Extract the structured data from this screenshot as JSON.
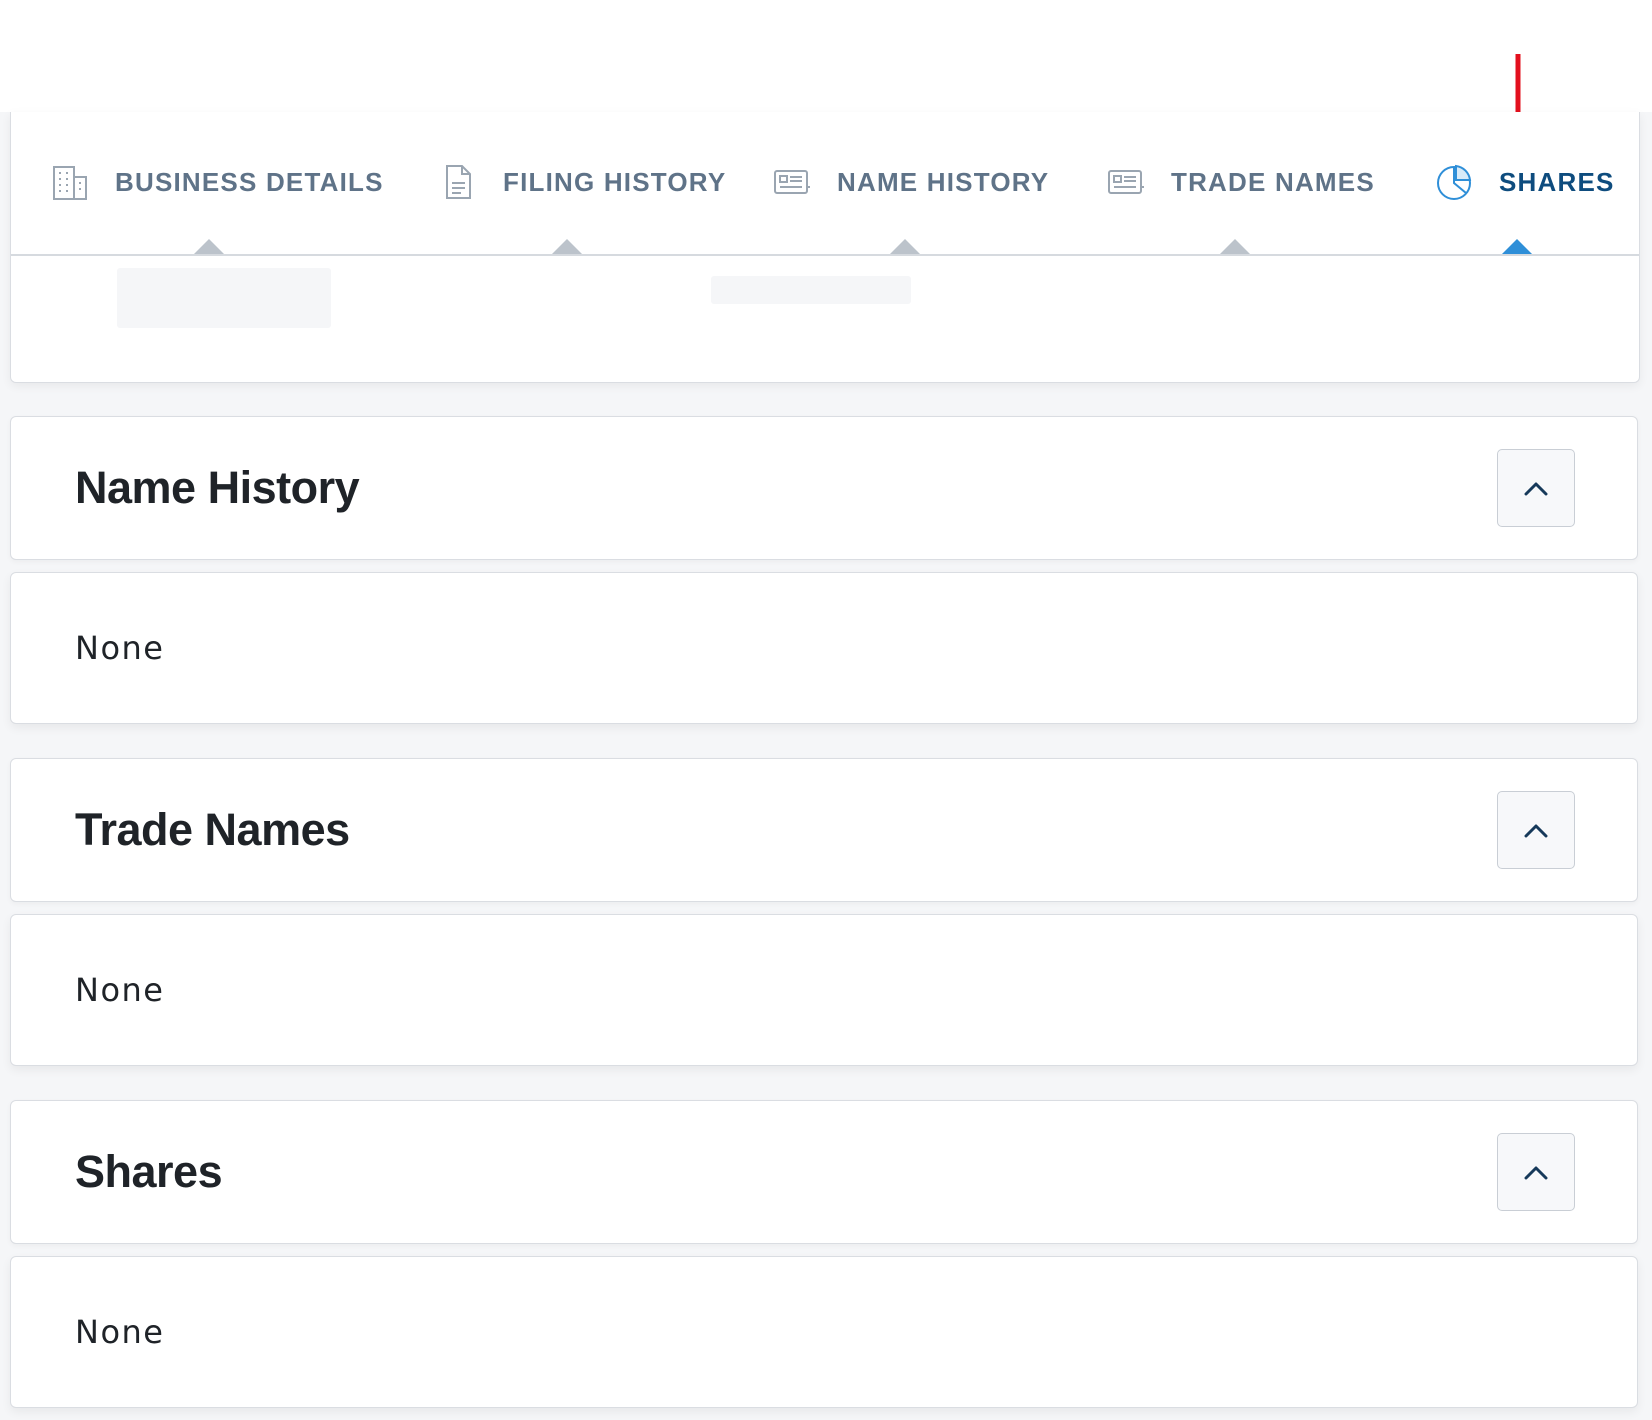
{
  "tabs": [
    {
      "label": "BUSINESS DETAILS",
      "icon": "building-icon",
      "active": false
    },
    {
      "label": "FILING HISTORY",
      "icon": "document-icon",
      "active": false
    },
    {
      "label": "NAME HISTORY",
      "icon": "id-card-icon",
      "active": false
    },
    {
      "label": "TRADE NAMES",
      "icon": "id-card-icon",
      "active": false
    },
    {
      "label": "SHARES",
      "icon": "pie-chart-icon",
      "active": true
    }
  ],
  "sections": [
    {
      "title": "Name History",
      "content": "None"
    },
    {
      "title": "Trade Names",
      "content": "None"
    },
    {
      "title": "Shares",
      "content": "None"
    }
  ],
  "colors": {
    "tab_text": "#5f7388",
    "tab_active_text": "#0e4c7e",
    "tab_active_indicator": "#2f8fd8",
    "annotation_arrow": "#e3101e"
  }
}
